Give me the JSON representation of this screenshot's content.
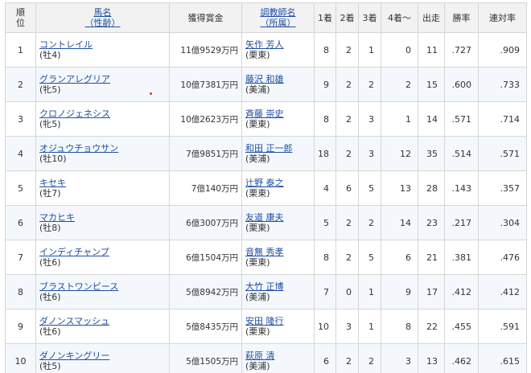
{
  "headers": {
    "rank": [
      "順",
      "位"
    ],
    "horse": [
      "馬名",
      "（性齢）"
    ],
    "prize": "獲得賞金",
    "trainer": [
      "調教師名",
      "（所属）"
    ],
    "first": "1着",
    "second": "2着",
    "third": "3着",
    "fourth_plus": "4着～",
    "starts": "出走",
    "win_rate": "勝率",
    "place_rate": "連対率"
  },
  "rows": [
    {
      "rank": "1",
      "name": "コントレイル",
      "sexage": "(牡4)",
      "prize": "11億9529万円",
      "trainer": "矢作 芳人",
      "affil": "(栗東)",
      "w1": "8",
      "w2": "2",
      "w3": "1",
      "w4": "0",
      "starts": "11",
      "win": ".727",
      "place": ".909"
    },
    {
      "rank": "2",
      "name": "グランアレグリア",
      "sexage": "(牝5)",
      "prize": "10億7381万円",
      "trainer": "藤沢 和雄",
      "affil": "(美浦)",
      "w1": "9",
      "w2": "2",
      "w3": "2",
      "w4": "2",
      "starts": "15",
      "win": ".600",
      "place": ".733"
    },
    {
      "rank": "3",
      "name": "クロノジェネシス",
      "sexage": "(牝5)",
      "prize": "10億2623万円",
      "trainer": "斉藤 崇史",
      "affil": "(栗東)",
      "w1": "8",
      "w2": "2",
      "w3": "3",
      "w4": "1",
      "starts": "14",
      "win": ".571",
      "place": ".714"
    },
    {
      "rank": "4",
      "name": "オジュウチョウサン",
      "sexage": "(牡10)",
      "prize": "7億9851万円",
      "trainer": "和田 正一郎",
      "affil": "(美浦)",
      "w1": "18",
      "w2": "2",
      "w3": "3",
      "w4": "12",
      "starts": "35",
      "win": ".514",
      "place": ".571"
    },
    {
      "rank": "5",
      "name": "キセキ",
      "sexage": "(牡7)",
      "prize": "7億140万円",
      "trainer": "辻野 泰之",
      "affil": "(栗東)",
      "w1": "4",
      "w2": "6",
      "w3": "5",
      "w4": "13",
      "starts": "28",
      "win": ".143",
      "place": ".357"
    },
    {
      "rank": "6",
      "name": "マカヒキ",
      "sexage": "(牡8)",
      "prize": "6億3007万円",
      "trainer": "友道 康夫",
      "affil": "(栗東)",
      "w1": "5",
      "w2": "2",
      "w3": "2",
      "w4": "14",
      "starts": "23",
      "win": ".217",
      "place": ".304"
    },
    {
      "rank": "7",
      "name": "インディチャンプ",
      "sexage": "(牡6)",
      "prize": "6億1504万円",
      "trainer": "音無 秀孝",
      "affil": "(栗東)",
      "w1": "8",
      "w2": "2",
      "w3": "5",
      "w4": "6",
      "starts": "21",
      "win": ".381",
      "place": ".476"
    },
    {
      "rank": "8",
      "name": "ブラストワンピース",
      "sexage": "(牡6)",
      "prize": "5億8942万円",
      "trainer": "大竹 正博",
      "affil": "(美浦)",
      "w1": "7",
      "w2": "0",
      "w3": "1",
      "w4": "9",
      "starts": "17",
      "win": ".412",
      "place": ".412"
    },
    {
      "rank": "9",
      "name": "ダノンスマッシュ",
      "sexage": "(牡6)",
      "prize": "5億8435万円",
      "trainer": "安田 隆行",
      "affil": "(栗東)",
      "w1": "10",
      "w2": "3",
      "w3": "1",
      "w4": "8",
      "starts": "22",
      "win": ".455",
      "place": ".591"
    },
    {
      "rank": "10",
      "name": "ダノンキングリー",
      "sexage": "(牡5)",
      "prize": "5億1505万円",
      "trainer": "萩原 清",
      "affil": "(美浦)",
      "w1": "6",
      "w2": "2",
      "w3": "2",
      "w4": "3",
      "starts": "13",
      "win": ".462",
      "place": ".615"
    }
  ]
}
